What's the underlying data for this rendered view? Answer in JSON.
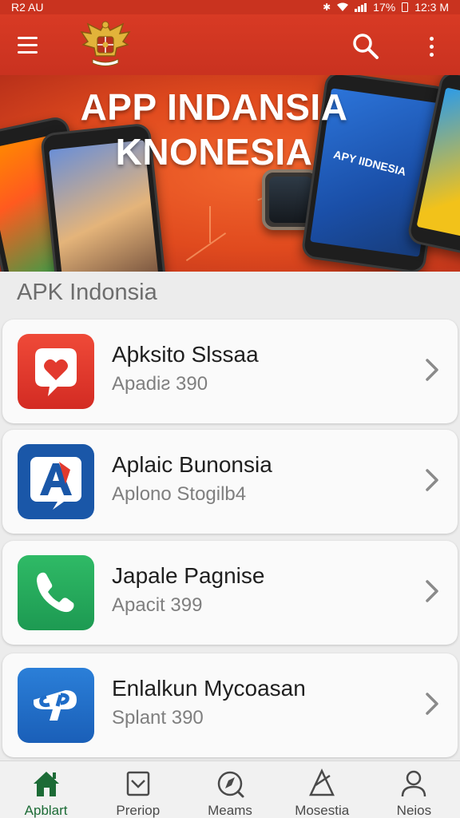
{
  "status_bar": {
    "carrier": "R2 AU",
    "battery": "17%",
    "time": "12:3 M"
  },
  "app_bar": {
    "menu_icon": "hamburger-menu-icon",
    "logo_icon": "garuda-emblem-icon",
    "search_icon": "search-icon",
    "more_icon": "more-vertical-icon"
  },
  "banner": {
    "title_line1": "APP INDANSIA",
    "title_line2": "KNONESIA",
    "phone_label": "APY IIDNESIA"
  },
  "section": {
    "title": "APK Indonsia"
  },
  "apps": [
    {
      "name": "Aþksito Slssaa",
      "subtitle": "Apadiƨ 390",
      "icon": "heart-chat-icon",
      "color": "#e23a2e"
    },
    {
      "name": "Aplaic Bunonsia",
      "subtitle": "Aplono Stogilb4",
      "icon": "letter-a-icon",
      "color": "#1a57a8"
    },
    {
      "name": "Japale Pagnise",
      "subtitle": "Apacit 399",
      "icon": "phone-call-icon",
      "color": "#22a35a"
    },
    {
      "name": "Enlalkun Mycoasan",
      "subtitle": "Splant 390",
      "icon": "cp-logo-icon",
      "color": "#1e6cc8"
    }
  ],
  "bottom_nav": [
    {
      "label": "Apblart",
      "icon": "home-icon",
      "active": true
    },
    {
      "label": "Preriop",
      "icon": "inbox-icon",
      "active": false
    },
    {
      "label": "Meams",
      "icon": "compass-icon",
      "active": false
    },
    {
      "label": "Mosestia",
      "icon": "triangle-pen-icon",
      "active": false
    },
    {
      "label": "Neios",
      "icon": "person-icon",
      "active": false
    }
  ],
  "colors": {
    "primary": "#d83a24",
    "active_nav": "#1c6b36"
  }
}
